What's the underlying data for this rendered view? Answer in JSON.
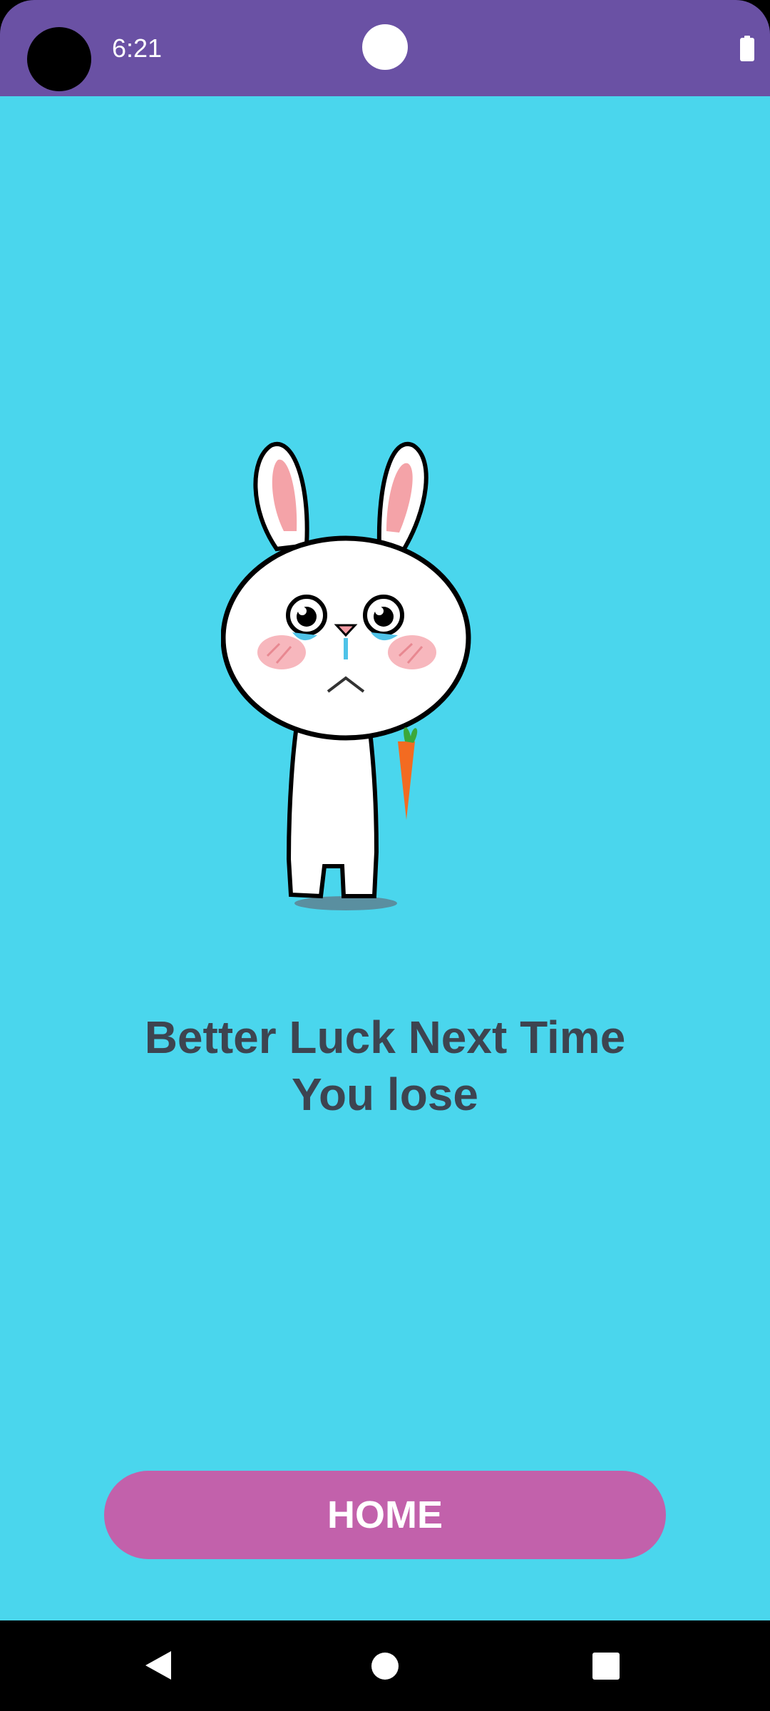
{
  "status_bar": {
    "time": "6:21",
    "background": "#6a51a4",
    "icons": [
      "camera-cutout",
      "notch-dot",
      "battery-icon"
    ]
  },
  "main": {
    "background": "#4ad6ed",
    "illustration": "crying-bunny-with-carrot",
    "message_line1": "Better Luck Next Time",
    "message_line2": "You lose",
    "message_color": "#3d4450"
  },
  "home_button": {
    "label": "HOME",
    "background": "#c261ab"
  },
  "nav_bar": {
    "icons": [
      "back-icon",
      "home-icon",
      "recents-icon"
    ]
  }
}
